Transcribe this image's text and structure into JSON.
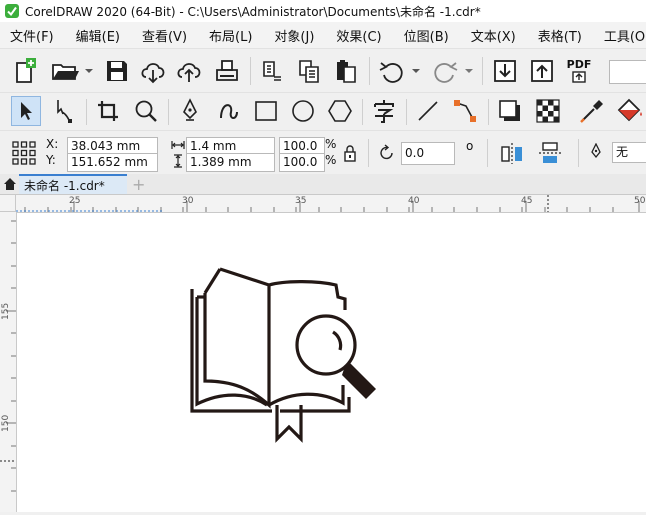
{
  "window": {
    "title": "CorelDRAW 2020 (64-Bit) - C:\\Users\\Administrator\\Documents\\未命名 -1.cdr*"
  },
  "menu": [
    {
      "label": "文件(F)"
    },
    {
      "label": "编辑(E)"
    },
    {
      "label": "查看(V)"
    },
    {
      "label": "布局(L)"
    },
    {
      "label": "对象(J)"
    },
    {
      "label": "效果(C)"
    },
    {
      "label": "位图(B)"
    },
    {
      "label": "文本(X)"
    },
    {
      "label": "表格(T)"
    },
    {
      "label": "工具(O)"
    }
  ],
  "standard_toolbar": {
    "pdf_label": "PDF",
    "zoom_value": ""
  },
  "property_bar": {
    "x_label": "X:",
    "x_value": "38.043 mm",
    "y_label": "Y:",
    "y_value": "151.652 mm",
    "width_value": "1.4 mm",
    "height_value": "1.389 mm",
    "scale_x": "100.0",
    "scale_y": "100.0",
    "percent_symbol": "%",
    "rotation_value": "0.0",
    "degree_symbol": "o",
    "outline_value": "无"
  },
  "tabs": {
    "document_tab": "未命名 -1.cdr*",
    "add_tab_symbol": "+"
  },
  "rulers": {
    "top_ticks": [
      "25",
      "30",
      "35",
      "40",
      "45",
      "50"
    ],
    "left_ticks": [
      "155",
      "150"
    ]
  },
  "colors": {
    "accent": "#3a7fd0",
    "logo_green": "#3cae3c",
    "drawing_stroke": "#231815"
  }
}
